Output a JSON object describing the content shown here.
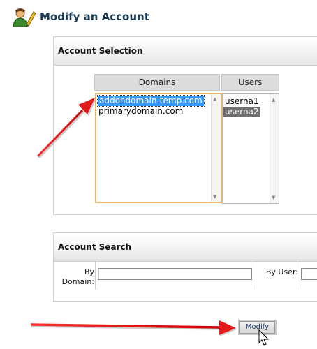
{
  "header": {
    "title": "Modify an Account",
    "icon": "user-pencil-icon"
  },
  "account_selection": {
    "title": "Account Selection",
    "domains_header": "Domains",
    "users_header": "Users",
    "domains": [
      "addondomain-temp.com",
      "primarydomain.com"
    ],
    "selected_domain": "addondomain-temp.com",
    "users": [
      "userna1",
      "userna2"
    ],
    "selected_user": "userna2"
  },
  "account_search": {
    "title": "Account Search",
    "by_domain_label": "By Domain:",
    "by_user_label": "By User:",
    "by_domain_value": "",
    "by_user_value": ""
  },
  "modify_button": "Modify",
  "colors": {
    "title": "#173a52",
    "selected_domain_bg": "#3399ff",
    "selected_user_bg": "#6f6f6f",
    "arrow": "#e41b1b"
  }
}
